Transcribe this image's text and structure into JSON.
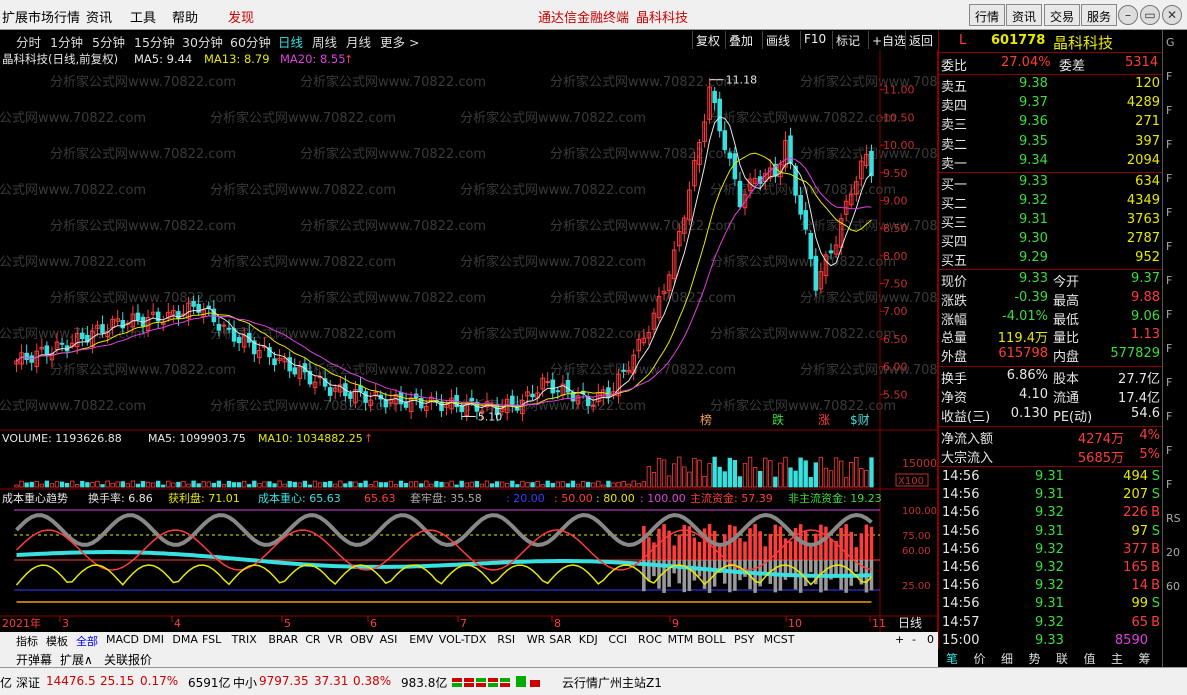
{
  "topbar": {
    "menus": [
      "扩展市场行情",
      "资讯",
      "工具",
      "帮助",
      "发现"
    ],
    "promos": [
      "通达信金融终端",
      "晶科科技"
    ],
    "buttons": [
      "行情",
      "资讯",
      "交易",
      "服务"
    ],
    "window_controls": [
      "minimize-icon",
      "restore-icon",
      "close-icon"
    ]
  },
  "periods": [
    "分时",
    "1分钟",
    "5分钟",
    "15分钟",
    "30分钟",
    "60分钟",
    "日线",
    "周线",
    "月线",
    "更多 >"
  ],
  "period_selected": "日线",
  "chart_tools": [
    "复权",
    "叠加",
    "画线",
    "F10",
    "标记",
    "+自选",
    "返回"
  ],
  "main_chart": {
    "title": "晶科科技(日线,前复权)",
    "ma5": "MA5: 9.44",
    "ma13": "MA13: 8.79",
    "ma20": "MA20: 8.55",
    "high_label": "11.18",
    "low_label": "5.10",
    "price_ticks": [
      "11.00",
      "10.50",
      "10.00",
      "9.50",
      "9.00",
      "8.50",
      "8.00",
      "7.50",
      "7.00",
      "6.50",
      "6.00",
      "5.50"
    ],
    "tags": [
      "榜",
      "跌",
      "涨",
      "$财"
    ],
    "watermark": "分析家公式网www.70822.com"
  },
  "volume": {
    "title": "VOLUME: 1193626.88",
    "ma5": "MA5: 1099903.75",
    "ma10": "MA10: 1034882.25",
    "tick": "15000",
    "unit": "X100"
  },
  "indicator": {
    "title": "成本重心趋势",
    "turnover": "换手率: 6.86",
    "profit": "获利盘: 71.01",
    "cost_center": "成本重心: 65.63",
    "v65": "65.63",
    "trapped": "套牢盘: 35.58",
    "levels": [
      ": 20.00",
      ": 50.00",
      ": 80.00",
      ": 100.00"
    ],
    "main_fund": "主流资金: 57.39",
    "non_main_fund": "非主流资金: 19.23",
    "ticks": [
      "100.00",
      "75.00",
      "60.00",
      "25.00"
    ]
  },
  "time_axis": {
    "year_label": "2021年",
    "months": [
      "3",
      "4",
      "5",
      "6",
      "7",
      "8",
      "9",
      "10",
      "11"
    ],
    "period_label": "日线"
  },
  "indicators": [
    "指标",
    "模板",
    "全部",
    "MACD",
    "DMI",
    "DMA",
    "FSL",
    "TRIX",
    "BRAR",
    "CR",
    "VR",
    "OBV",
    "ASI",
    "EMV",
    "VOL-TDX",
    "RSI",
    "WR",
    "SAR",
    "KDJ",
    "CCI",
    "ROC",
    "MTM",
    "BOLL",
    "PSY",
    "MCST"
  ],
  "indicator_selected": "全部",
  "indicator_nav": [
    "+",
    "-",
    "0"
  ],
  "bottombar": [
    "开弹幕",
    "扩展∧",
    "关联报价"
  ],
  "status": {
    "prefix": "亿",
    "shenzhen_label": "深证",
    "shenzhen_value": "14476.5",
    "shenzhen_change": "25.15",
    "shenzhen_pct": "0.17%",
    "shenzhen_amount": "6591亿",
    "smallcap_label": "中小",
    "smallcap_value": "9797.35",
    "smallcap_change": "37.31",
    "smallcap_pct": "0.38%",
    "smallcap_amount": "983.8亿",
    "server": "云行情广州主站Z1"
  },
  "quote": {
    "flag": "L",
    "code": "601778",
    "name": "晶科科技",
    "weibi_label": "委比",
    "weibi_value": "27.04%",
    "weicha_label": "委差",
    "weicha_value": "5314",
    "asks": [
      {
        "label": "卖五",
        "price": "9.38",
        "vol": "120"
      },
      {
        "label": "卖四",
        "price": "9.37",
        "vol": "4289"
      },
      {
        "label": "卖三",
        "price": "9.36",
        "vol": "271"
      },
      {
        "label": "卖二",
        "price": "9.35",
        "vol": "397"
      },
      {
        "label": "卖一",
        "price": "9.34",
        "vol": "2094"
      }
    ],
    "bids": [
      {
        "label": "买一",
        "price": "9.33",
        "vol": "634"
      },
      {
        "label": "买二",
        "price": "9.32",
        "vol": "4349"
      },
      {
        "label": "买三",
        "price": "9.31",
        "vol": "3763"
      },
      {
        "label": "买四",
        "price": "9.30",
        "vol": "2787"
      },
      {
        "label": "买五",
        "price": "9.29",
        "vol": "952"
      }
    ],
    "stats": [
      {
        "l1": "现价",
        "v1": "9.33",
        "c1": "c-green",
        "l2": "今开",
        "v2": "9.37",
        "c2": "c-green"
      },
      {
        "l1": "涨跌",
        "v1": "-0.39",
        "c1": "c-green",
        "l2": "最高",
        "v2": "9.88",
        "c2": "c-red"
      },
      {
        "l1": "涨幅",
        "v1": "-4.01%",
        "c1": "c-green",
        "l2": "最低",
        "v2": "9.06",
        "c2": "c-green"
      },
      {
        "l1": "总量",
        "v1": "119.4万",
        "c1": "c-yel",
        "l2": "量比",
        "v2": "1.13",
        "c2": "c-red"
      },
      {
        "l1": "外盘",
        "v1": "615798",
        "c1": "c-red",
        "l2": "内盘",
        "v2": "577829",
        "c2": "c-green"
      }
    ],
    "stats2": [
      {
        "l1": "换手",
        "v1": "6.86%",
        "l2": "股本",
        "v2": "27.7亿"
      },
      {
        "l1": "净资",
        "v1": "4.10",
        "l2": "流通",
        "v2": "17.4亿"
      },
      {
        "l1": "收益(三)",
        "v1": "0.130",
        "l2": "PE(动)",
        "v2": "54.6"
      }
    ],
    "flows": [
      {
        "label": "净流入额",
        "value": "4274万",
        "pct": "4%"
      },
      {
        "label": "大宗流入",
        "value": "5685万",
        "pct": "5%"
      }
    ],
    "ticks": [
      {
        "time": "14:56",
        "price": "9.31",
        "vol": "494",
        "bs": "S"
      },
      {
        "time": "14:56",
        "price": "9.31",
        "vol": "207",
        "bs": "S"
      },
      {
        "time": "14:56",
        "price": "9.32",
        "vol": "226",
        "bs": "B"
      },
      {
        "time": "14:56",
        "price": "9.31",
        "vol": "97",
        "bs": "S"
      },
      {
        "time": "14:56",
        "price": "9.32",
        "vol": "377",
        "bs": "B"
      },
      {
        "time": "14:56",
        "price": "9.32",
        "vol": "165",
        "bs": "B"
      },
      {
        "time": "14:56",
        "price": "9.32",
        "vol": "14",
        "bs": "B"
      },
      {
        "time": "14:56",
        "price": "9.31",
        "vol": "99",
        "bs": "S"
      },
      {
        "time": "14:57",
        "price": "9.32",
        "vol": "65",
        "bs": "B"
      },
      {
        "time": "15:00",
        "price": "9.33",
        "vol": "8590",
        "bs": ""
      }
    ]
  },
  "quote_tabs": [
    "笔",
    "价",
    "细",
    "势",
    "联",
    "值",
    "主",
    "筹"
  ],
  "quote_tab_selected": "笔",
  "edge_labels": [
    "G",
    "F",
    "F",
    "F",
    "F",
    "F",
    "F",
    "F",
    "F",
    "F",
    "F",
    "F",
    "F",
    "F",
    "RS",
    "20",
    "60"
  ]
}
